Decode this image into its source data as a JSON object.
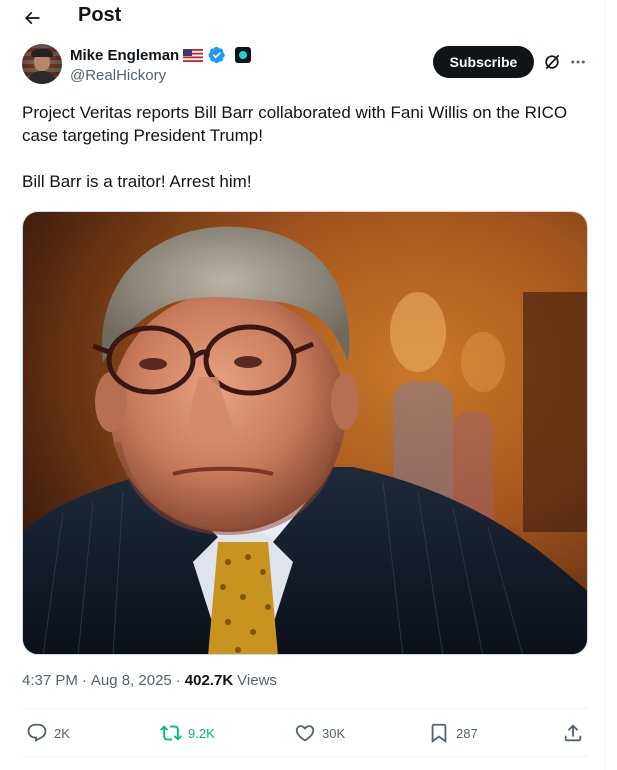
{
  "header": {
    "title": "Post"
  },
  "author": {
    "name": "Mike Engleman",
    "handle": "@RealHickory",
    "subscribe_label": "Subscribe"
  },
  "post": {
    "paragraphs": [
      "Project Veritas reports Bill Barr collaborated with Fani Willis on the RICO case targeting President Trump!",
      "Bill Barr is a traitor! Arrest him!"
    ],
    "time": "4:37 PM",
    "date": "Aug 8, 2025",
    "views_count": "402.7K",
    "views_label": "Views",
    "separator": "·"
  },
  "actions": {
    "replies": "2K",
    "reposts": "9.2K",
    "likes": "30K",
    "bookmarks": "287"
  },
  "colors": {
    "text": "#0f1419",
    "secondary": "#536471",
    "verified": "#1d9bf0",
    "repost_active": "#00ba7c"
  },
  "icons": [
    "back-arrow-icon",
    "flag-us-icon",
    "verified-badge-icon",
    "affiliate-badge-icon",
    "grok-icon",
    "more-icon",
    "reply-icon",
    "repost-icon",
    "like-icon",
    "bookmark-icon",
    "share-icon"
  ]
}
